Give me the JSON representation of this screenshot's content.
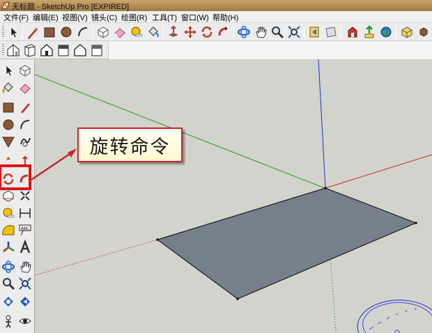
{
  "window": {
    "title": "无标题 - SketchUp Pro [EXPIRED]"
  },
  "menu": {
    "items": [
      "文件(F)",
      "编辑(E)",
      "视图(V)",
      "镜头(C)",
      "绘图(R)",
      "工具(T)",
      "窗口(W)",
      "帮助(H)"
    ]
  },
  "toolbar_main": {
    "tools": [
      "select-icon",
      "pencil-line-icon",
      "rectangle-icon",
      "circle-icon",
      "arc-icon",
      "eraser-icon",
      "paint-bucket-icon",
      "push-pull-icon",
      "move-icon",
      "rotate-icon",
      "follow-me-icon",
      "orbit-icon",
      "pan-icon",
      "zoom-icon",
      "zoom-extents-icon",
      "previous-view-icon",
      "next-view-icon",
      "get-models-icon",
      "share-model-icon",
      "google-earth-icon",
      "components-icon",
      "more-tools-icon"
    ]
  },
  "toolbar_views": {
    "tools": [
      "iso-view-icon",
      "top-view-icon",
      "front-view-icon",
      "right-view-icon",
      "back-view-icon",
      "left-view-icon"
    ]
  },
  "left_toolbar": {
    "tools": [
      "select-icon",
      "component-icon",
      "paint-bucket-icon",
      "eraser-icon",
      "rectangle-icon",
      "line-icon",
      "circle-icon",
      "arc-icon",
      "polygon-icon",
      "freehand-icon",
      "move-icon",
      "push-pull-icon",
      "rotate-icon",
      "follow-me-icon",
      "scale-icon",
      "offset-icon",
      "tape-measure-icon",
      "dimension-icon",
      "protractor-icon",
      "text-icon",
      "axes-icon",
      "3d-text-icon",
      "orbit-icon",
      "pan-icon",
      "zoom-icon",
      "zoom-window-icon",
      "zoom-extents-icon",
      "previous-view-icon",
      "position-camera-icon",
      "look-around-icon"
    ]
  },
  "annotation": {
    "text": "旋转命令",
    "border_color": "#c8232a"
  },
  "colors": {
    "viewport_bg": "#d3d3cd",
    "face": "#75808a",
    "axis_red": "#cc2b2b",
    "axis_green": "#2e9a2e",
    "axis_blue": "#1f2fcf",
    "highlight": "#e0141a"
  }
}
